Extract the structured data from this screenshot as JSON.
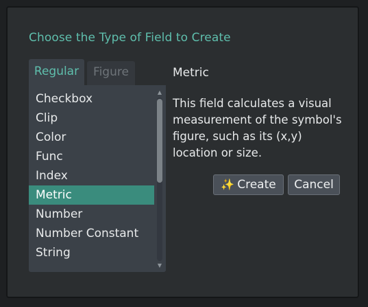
{
  "dialog": {
    "title": "Choose the Type of Field to Create"
  },
  "tabs": [
    {
      "label": "Regular",
      "active": true
    },
    {
      "label": "Figure",
      "active": false
    }
  ],
  "list": {
    "items": [
      "Checkbox",
      "Clip",
      "Color",
      "Func",
      "Index",
      "Metric",
      "Number",
      "Number Constant",
      "String"
    ],
    "selected": "Metric"
  },
  "detail": {
    "title": "Metric",
    "description": "This field calculates a visual measurement of the symbol's figure, such as its (x,y) location or size."
  },
  "buttons": {
    "create_icon": "sparkles-icon",
    "create_label": "Create",
    "cancel_label": "Cancel"
  },
  "colors": {
    "accent": "#5fbfad",
    "selection": "#3a8c7d"
  }
}
